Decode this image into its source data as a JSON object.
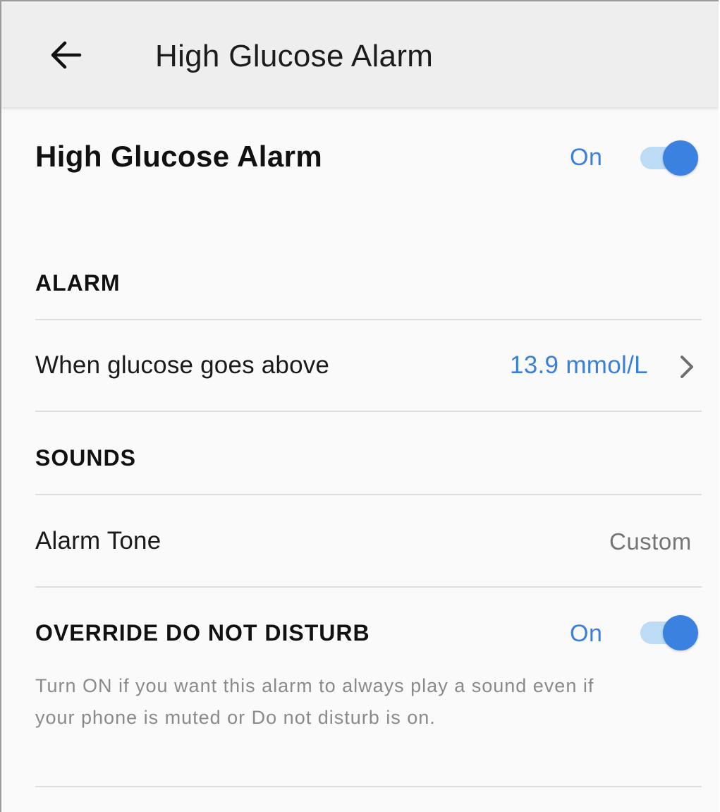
{
  "appbar": {
    "back_icon": "arrow-left-icon",
    "title": "High Glucose Alarm"
  },
  "main_toggle": {
    "title": "High Glucose Alarm",
    "state_label": "On",
    "checked": true
  },
  "sections": {
    "alarm_header": "ALARM",
    "sounds_header": "SOUNDS",
    "override_header": "OVERRIDE DO NOT DISTURB"
  },
  "threshold_row": {
    "label": "When glucose goes above",
    "value": "13.9 mmol/L",
    "chevron_icon": "chevron-right-icon"
  },
  "tone_row": {
    "label": "Alarm Tone",
    "value": "Custom"
  },
  "override": {
    "state_label": "On",
    "checked": true,
    "help_text": "Turn ON if you want this alarm to always play a sound even if your phone is muted or Do not disturb is on."
  },
  "colors": {
    "accent": "#3b82e0",
    "accent_text": "#3a7fdc",
    "toggle_track": "#bcdcf5",
    "appbar_bg": "#eeeeee",
    "page_bg": "#fafafa"
  }
}
